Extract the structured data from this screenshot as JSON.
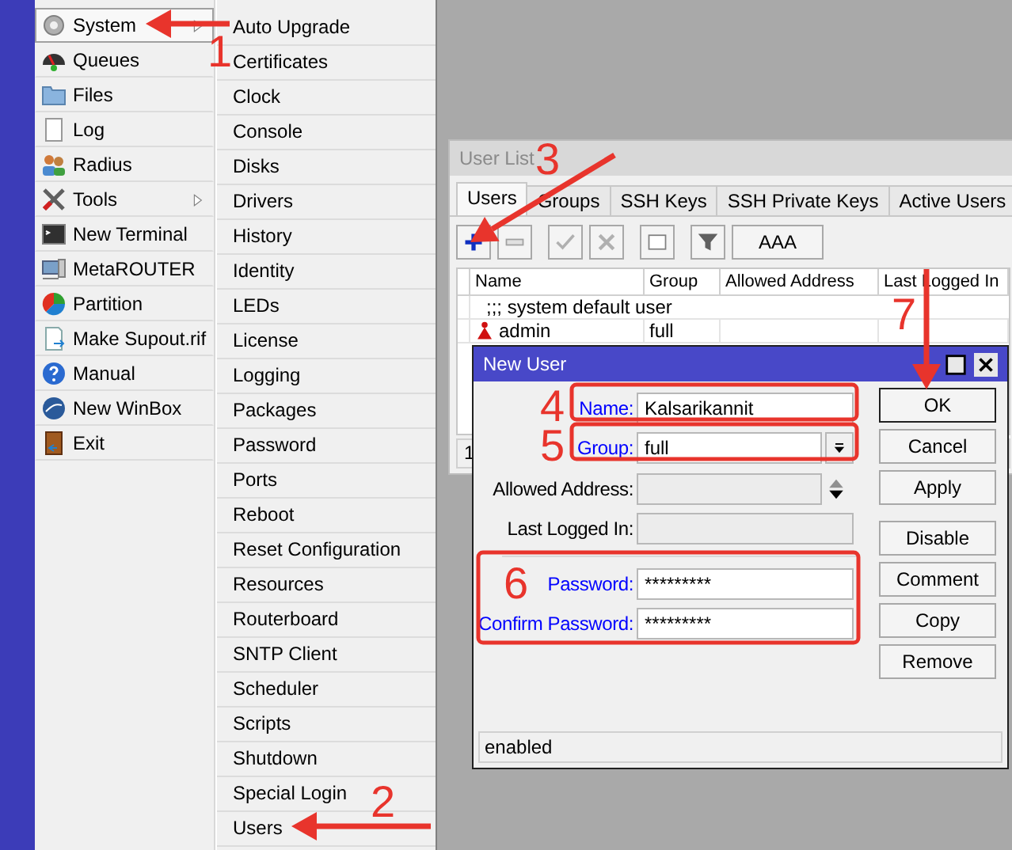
{
  "main_menu": [
    {
      "label": "System",
      "selected": true,
      "has_submenu": true
    },
    {
      "label": "Queues",
      "selected": false,
      "has_submenu": false
    },
    {
      "label": "Files",
      "selected": false,
      "has_submenu": false
    },
    {
      "label": "Log",
      "selected": false,
      "has_submenu": false
    },
    {
      "label": "Radius",
      "selected": false,
      "has_submenu": false
    },
    {
      "label": "Tools",
      "selected": false,
      "has_submenu": true
    },
    {
      "label": "New Terminal",
      "selected": false,
      "has_submenu": false
    },
    {
      "label": "MetaROUTER",
      "selected": false,
      "has_submenu": false
    },
    {
      "label": "Partition",
      "selected": false,
      "has_submenu": false
    },
    {
      "label": "Make Supout.rif",
      "selected": false,
      "has_submenu": false
    },
    {
      "label": "Manual",
      "selected": false,
      "has_submenu": false
    },
    {
      "label": "New WinBox",
      "selected": false,
      "has_submenu": false
    },
    {
      "label": "Exit",
      "selected": false,
      "has_submenu": false
    }
  ],
  "submenu": [
    "Auto Upgrade",
    "Certificates",
    "Clock",
    "Console",
    "Disks",
    "Drivers",
    "History",
    "Identity",
    "LEDs",
    "License",
    "Logging",
    "Packages",
    "Password",
    "Ports",
    "Reboot",
    "Reset Configuration",
    "Resources",
    "Routerboard",
    "SNTP Client",
    "Scheduler",
    "Scripts",
    "Shutdown",
    "Special Login",
    "Users"
  ],
  "user_list": {
    "title": "User List",
    "tabs": [
      {
        "label": "Users",
        "selected": true
      },
      {
        "label": "Groups",
        "selected": false
      },
      {
        "label": "SSH Keys",
        "selected": false
      },
      {
        "label": "SSH Private Keys",
        "selected": false
      },
      {
        "label": "Active Users",
        "selected": false
      }
    ],
    "aaa_button": "AAA",
    "columns": [
      "Name",
      "Group",
      "Allowed Address",
      "Last Logged In"
    ],
    "rows": [
      {
        "kind": "comment",
        "text": ";;; system default user"
      },
      {
        "kind": "user",
        "name": "admin",
        "group": "full"
      }
    ],
    "status": "1"
  },
  "new_user": {
    "title": "New User",
    "fields": [
      {
        "label": "Name:",
        "value": "Kalsarikannit",
        "kind": "text",
        "required": true,
        "disabled": false
      },
      {
        "label": "Group:",
        "value": "full",
        "kind": "dropdown",
        "required": true,
        "disabled": false
      },
      {
        "label": "Allowed Address:",
        "kind": "spinner",
        "required": false,
        "disabled": true
      },
      {
        "label": "Last Logged In:",
        "kind": "text",
        "required": false,
        "disabled": true
      },
      {
        "kind": "separator"
      },
      {
        "label": "Password:",
        "value": "*********",
        "kind": "password",
        "required": true,
        "disabled": false
      },
      {
        "label": "Confirm Password:",
        "value": "*********",
        "kind": "password",
        "required": true,
        "disabled": false
      }
    ],
    "buttons": [
      {
        "label": "OK",
        "default": true
      },
      {
        "label": "Cancel",
        "default": false
      },
      {
        "label": "Apply",
        "default": false
      }
    ],
    "item_buttons": [
      "Disable",
      "Comment",
      "Copy",
      "Remove"
    ],
    "status": "enabled"
  },
  "annotations": [
    "1",
    "2",
    "3",
    "4",
    "5",
    "6",
    "7"
  ]
}
